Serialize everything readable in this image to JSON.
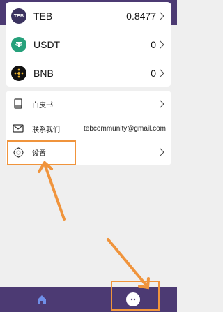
{
  "tokens": [
    {
      "symbol": "TEB",
      "icon": "teb-icon",
      "icon_text": "TEB",
      "value": "0.8477"
    },
    {
      "symbol": "USDT",
      "icon": "tether-icon",
      "value": "0"
    },
    {
      "symbol": "BNB",
      "icon": "bnb-icon",
      "value": "0"
    }
  ],
  "menu": {
    "whitepaper": {
      "label": "白皮书",
      "icon": "book-icon"
    },
    "contact": {
      "label": "联系我们",
      "value": "tebcommunity@gmail.com",
      "icon": "mail-icon"
    },
    "settings": {
      "label": "设置",
      "icon": "gear-icon"
    }
  },
  "bottom_nav": [
    {
      "name": "home",
      "icon": "home-icon"
    },
    {
      "name": "chat",
      "icon": "chat-bubble-icon",
      "active": true
    }
  ],
  "colors": {
    "header_bar": "#4c3a73",
    "nav_bar": "#4c3a73",
    "background": "#efefef",
    "annotation": "#f0943c",
    "usdt_green": "#26a17b",
    "bnb_yellow": "#f3ba2f"
  }
}
